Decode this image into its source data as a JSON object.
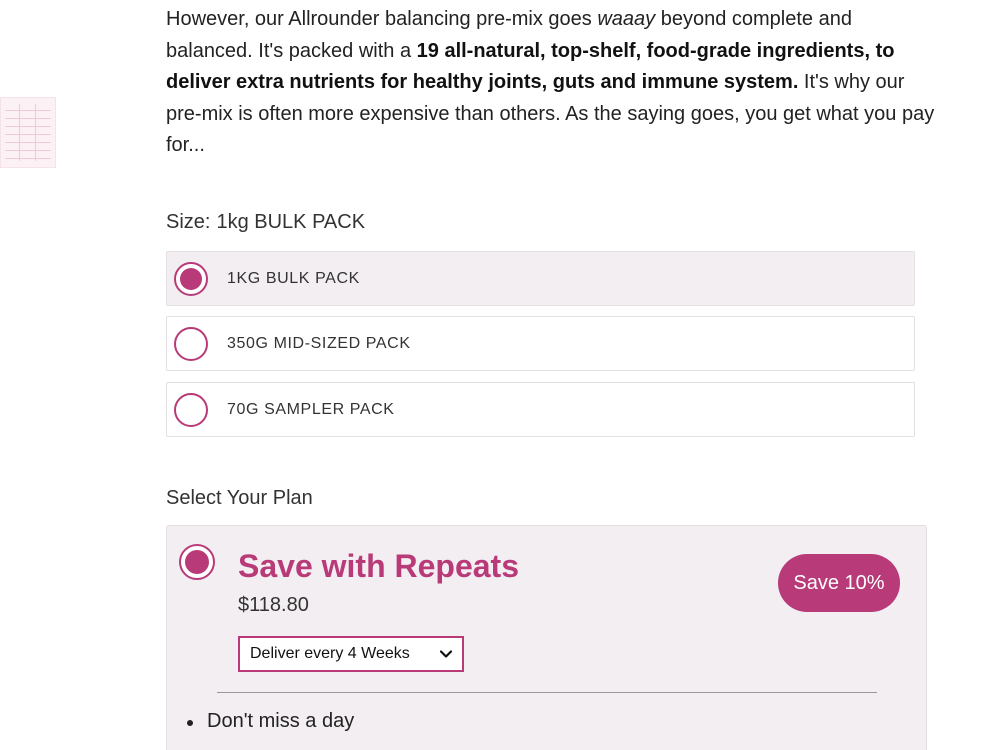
{
  "intro": {
    "p1": "However, our Allrounder balancing pre-mix goes ",
    "em": "waaay",
    "p2": " beyond complete and balanced. It's packed with a ",
    "bold": "19 all-natural, top-shelf, food-grade ingredients, to deliver extra nutrients for healthy joints, guts and immune system.",
    "p3": " It's why our pre-mix is often more expensive than others. As the saying goes, you get what you pay for..."
  },
  "size": {
    "label": "Size:",
    "selected_value": "1kg BULK PACK",
    "options": [
      {
        "label": "1KG BULK PACK",
        "selected": true
      },
      {
        "label": "350G MID-SIZED PACK",
        "selected": false
      },
      {
        "label": "70G SAMPLER PACK",
        "selected": false
      }
    ]
  },
  "plan": {
    "label": "Select Your Plan",
    "title": "Save with Repeats",
    "price": "$118.80",
    "badge": "Save 10%",
    "frequency": "Deliver every 4 Weeks",
    "benefits": [
      "Don't miss a day"
    ]
  },
  "colors": {
    "accent": "#b83a78",
    "selected_bg": "#f3eef1"
  }
}
